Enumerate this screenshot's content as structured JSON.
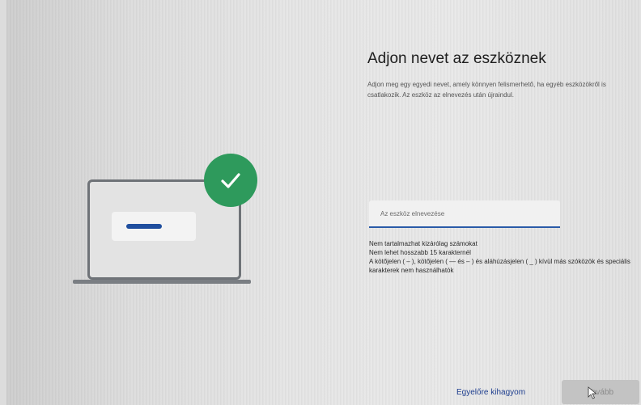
{
  "page": {
    "title": "Adjon nevet az eszköznek",
    "description": "Adjon meg egy egyedi nevet, amely könnyen felismerhető, ha egyéb eszközökről is csatlakozik. Az eszköz az elnevezés után újraindul."
  },
  "name_input": {
    "placeholder": "Az eszköz elnevezése",
    "value": ""
  },
  "rules": [
    "Nem tartalmazhat kizárólag számokat",
    "Nem lehet hosszabb 15 karakternél",
    "A kötőjelen ( – ), kötőjelen ( — és – ) és aláhúzásjelen ( _ ) kívül más szóközök és speciális karakterek nem használhatók"
  ],
  "footer": {
    "skip_label": "Egyelőre kihagyom",
    "next_label": "Tovább"
  },
  "colors": {
    "accent": "#2a5ba8",
    "success": "#2e9a5c",
    "link": "#1f3f8f"
  },
  "icons": {
    "checkmark": "checkmark-icon",
    "cursor": "mouse-pointer-icon"
  }
}
